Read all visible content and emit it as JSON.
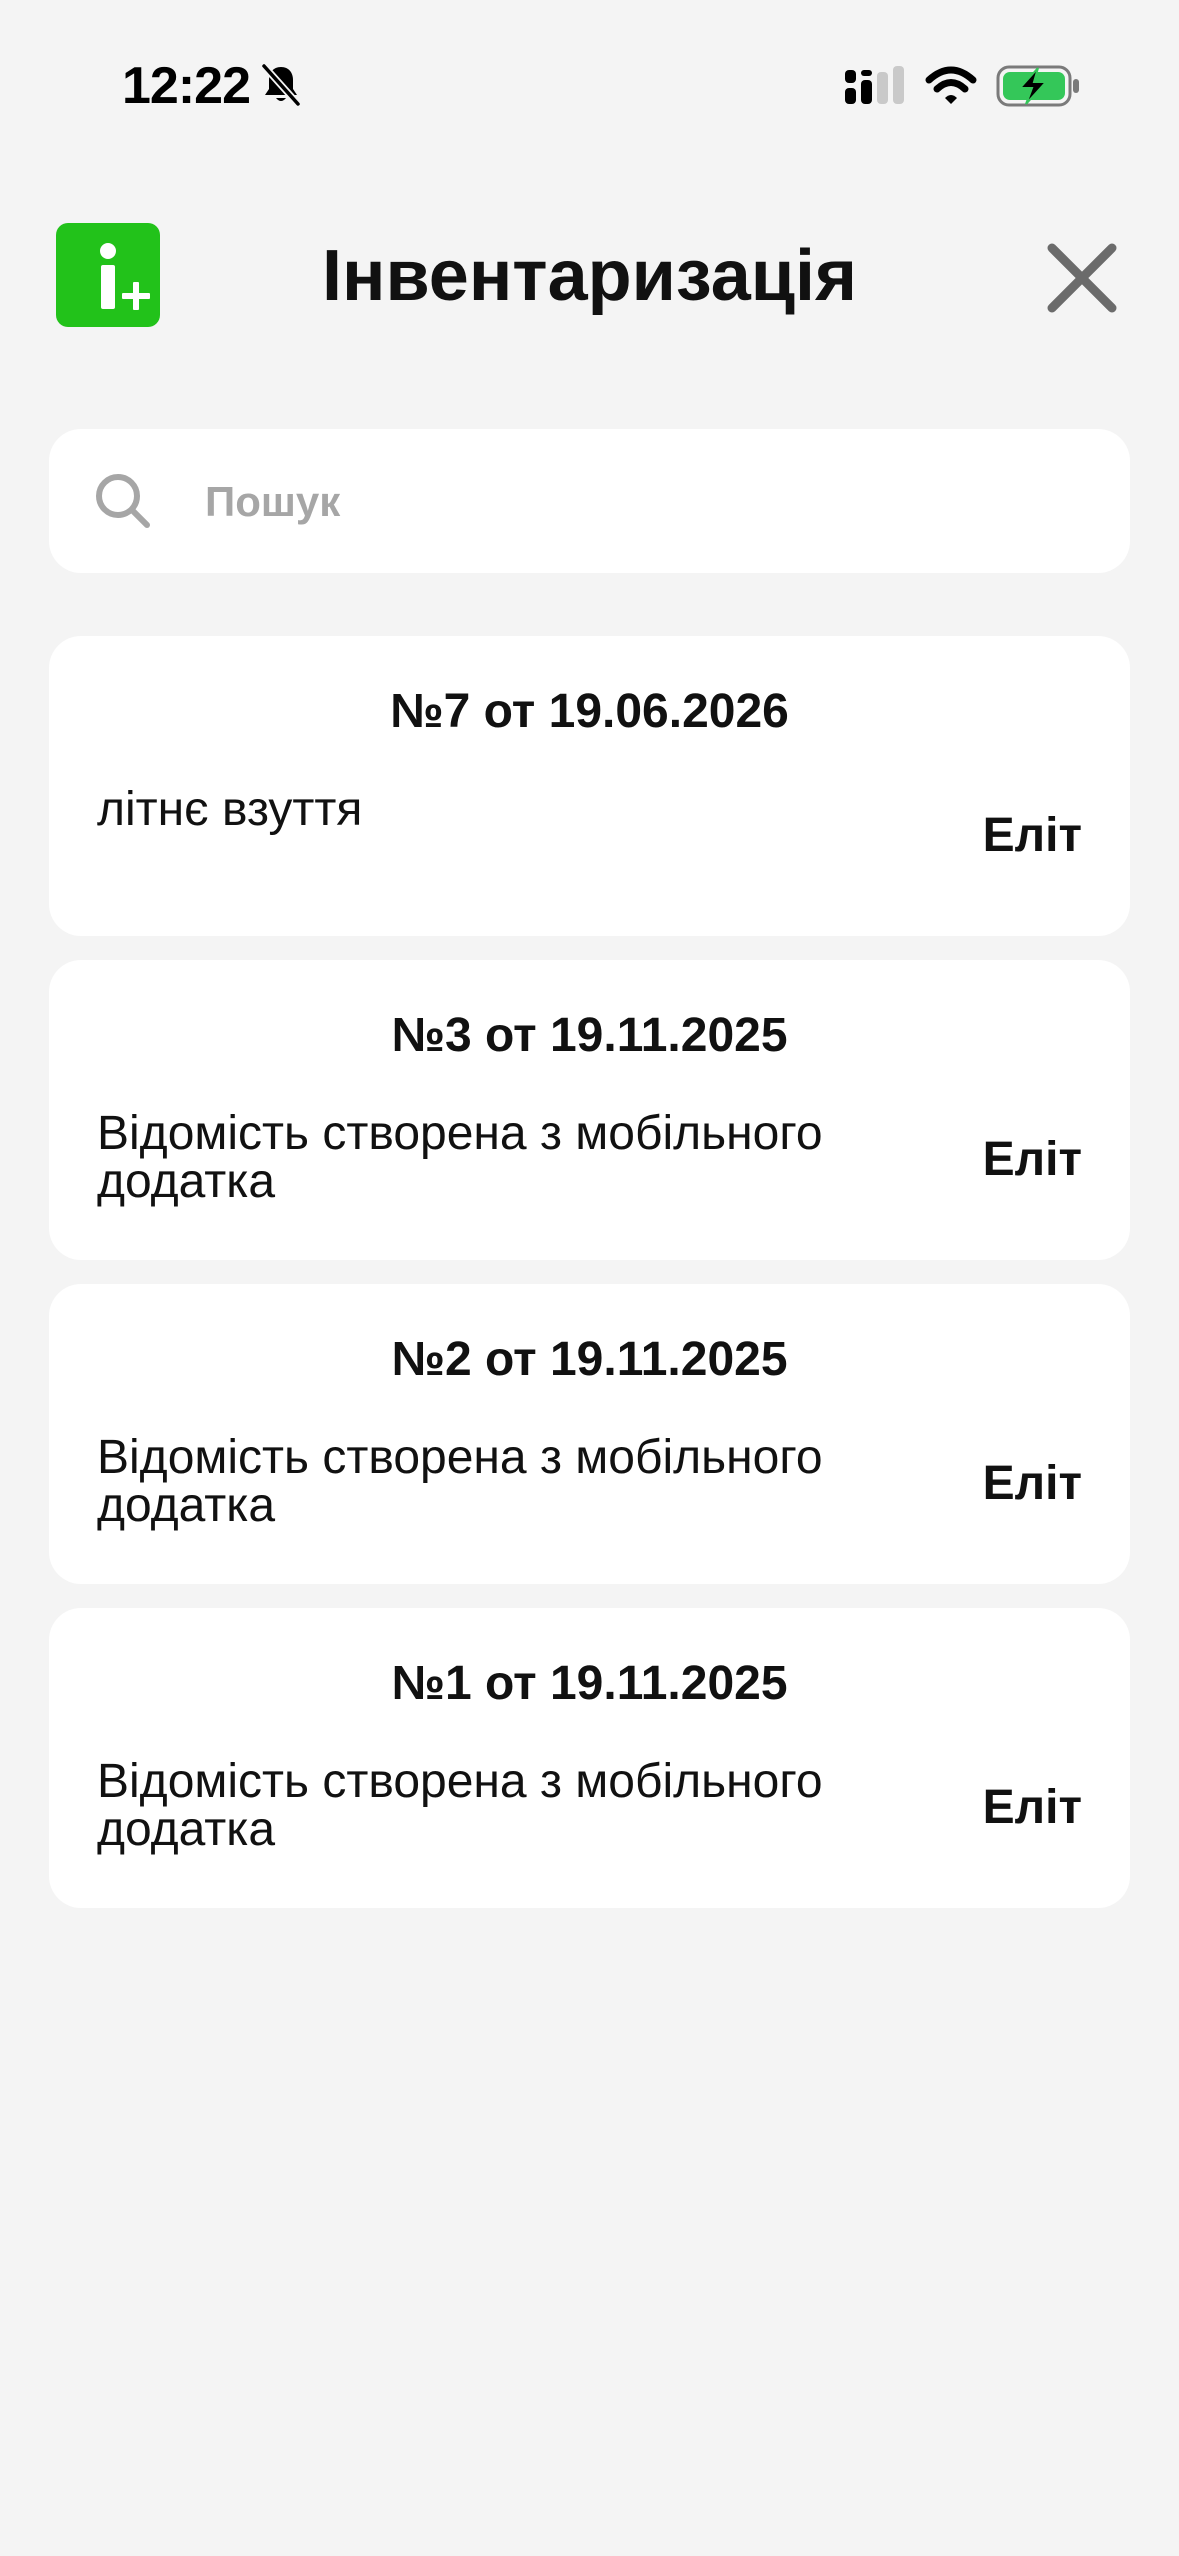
{
  "status_bar": {
    "time": "12:22",
    "icons": [
      "bell-slash-icon",
      "cellular-signal-icon",
      "wifi-icon",
      "battery-charging-icon"
    ],
    "battery_color": "#34c759"
  },
  "header": {
    "logo_icon": "inventory-plus-logo",
    "logo_color": "#22c21a",
    "title": "Інвентаризація",
    "close_icon": "close-icon"
  },
  "search": {
    "icon": "search-icon",
    "placeholder": "Пошук",
    "value": ""
  },
  "documents": [
    {
      "title": "№7 от 19.06.2026",
      "description": "літнє взуття",
      "store": "Еліт"
    },
    {
      "title": "№3 от 19.11.2025",
      "description": "Відомість створена з мобільного додатка",
      "store": "Еліт"
    },
    {
      "title": "№2 от 19.11.2025",
      "description": "Відомість створена з мобільного додатка",
      "store": "Еліт"
    },
    {
      "title": "№1 от 19.11.2025",
      "description": "Відомість створена з мобільного додатка",
      "store": "Еліт"
    }
  ]
}
